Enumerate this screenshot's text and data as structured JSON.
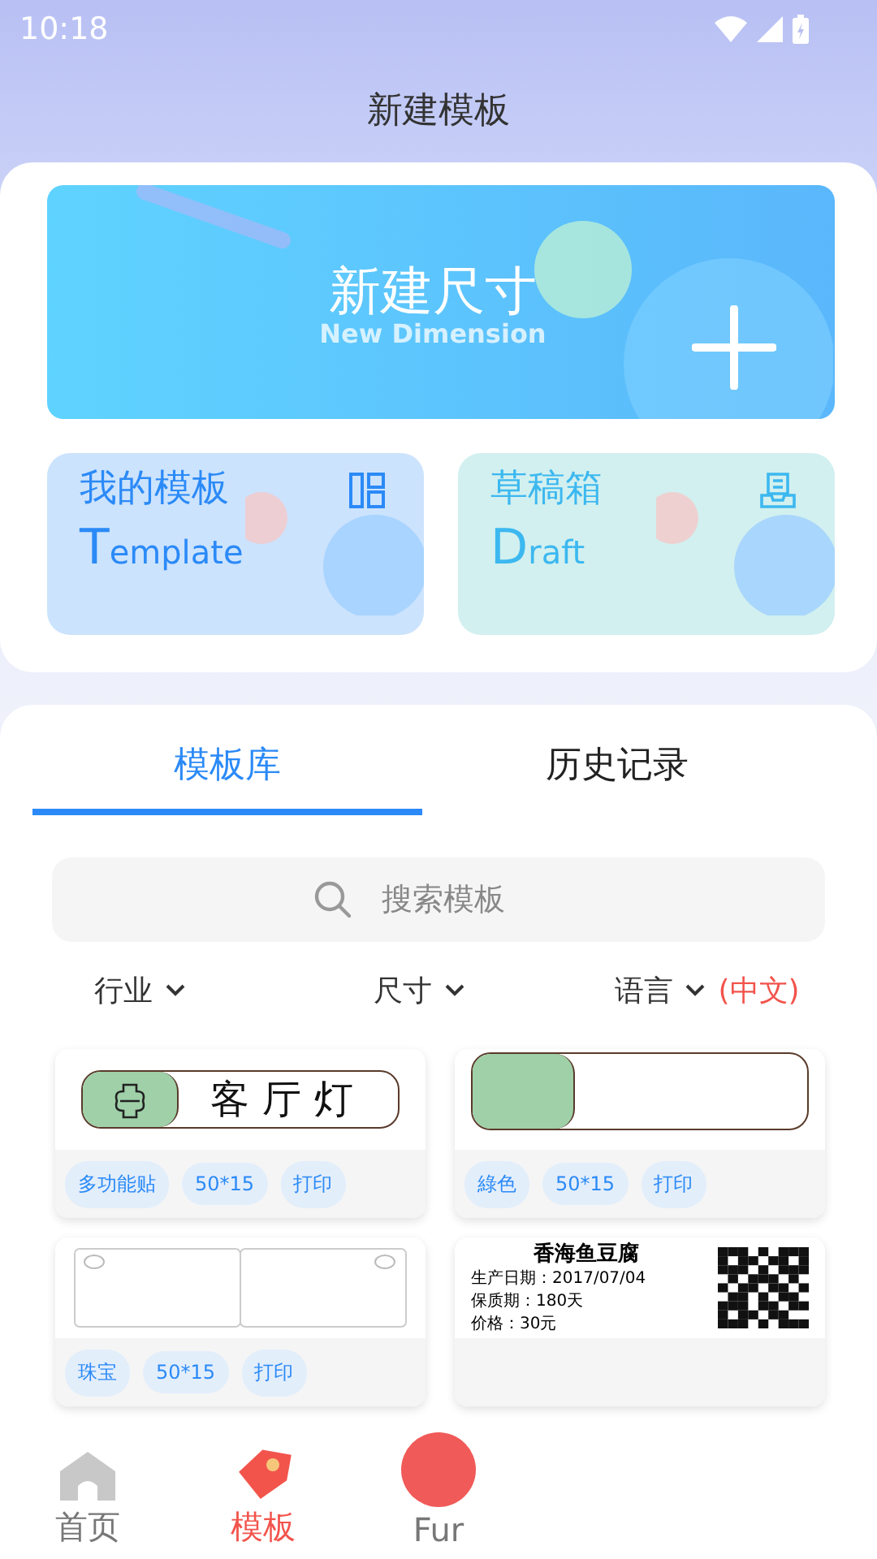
{
  "status_bar": {
    "time": "10:18"
  },
  "header": {
    "title": "新建模板"
  },
  "new_banner": {
    "title": "新建尺寸",
    "subtitle": "New Dimension"
  },
  "shortcuts": [
    {
      "kind": "template",
      "title": "我的模板",
      "initial": "T",
      "rest": "emplate"
    },
    {
      "kind": "draft",
      "title": "草稿箱",
      "initial": "D",
      "rest": "raft"
    }
  ],
  "tabs": [
    {
      "label": "模板库",
      "selected": true
    },
    {
      "label": "历史记录",
      "selected": false
    }
  ],
  "search": {
    "placeholder": "搜索模板"
  },
  "filters": [
    {
      "label": "行业"
    },
    {
      "label": "尺寸"
    },
    {
      "label": "语言",
      "value": "(中文)"
    }
  ],
  "templates": [
    {
      "kind": "icon-label",
      "preview_text": "客厅灯",
      "tags": [
        "多功能贴",
        "50*15",
        "打印"
      ]
    },
    {
      "kind": "blank-switch",
      "tags": [
        "綠色",
        "50*15",
        "打印"
      ]
    },
    {
      "kind": "double-tag",
      "tags": [
        "珠宝",
        "50*15",
        "打印"
      ]
    },
    {
      "kind": "food-label",
      "preview_lines": [
        "香海鱼豆腐",
        "生产日期：2017/07/04",
        "保质期：180天",
        "价格：30元"
      ]
    }
  ],
  "bottom_nav": [
    {
      "kind": "home",
      "label": "首页",
      "selected": false
    },
    {
      "kind": "tag",
      "label": "模板",
      "selected": true
    },
    {
      "kind": "circle",
      "label": "Fur",
      "selected": false
    }
  ]
}
